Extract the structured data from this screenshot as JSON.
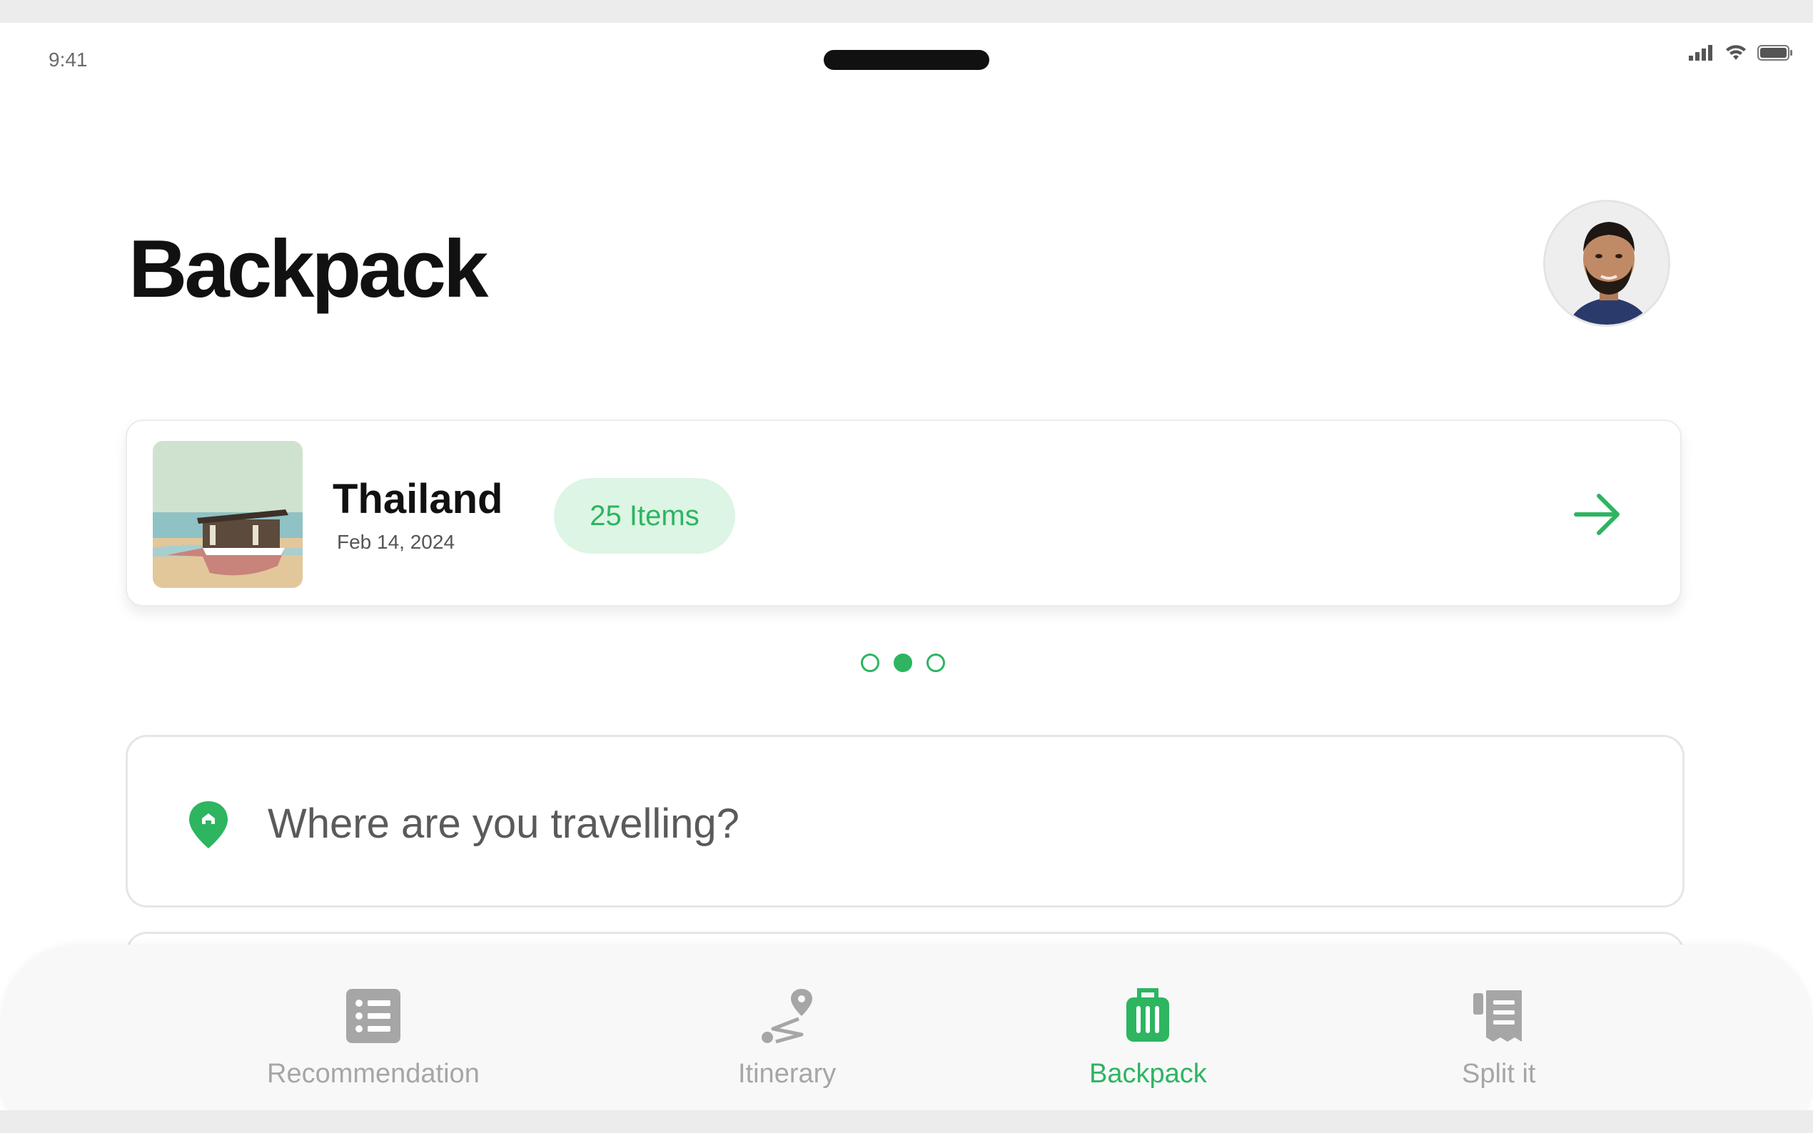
{
  "status_bar": {
    "time": "9:41"
  },
  "header": {
    "title": "Backpack"
  },
  "trip_card": {
    "name": "Thailand",
    "date": "Feb 14, 2024",
    "items_badge": "25 Items"
  },
  "pagination": {
    "total": 3,
    "active_index": 1
  },
  "search": {
    "placeholder": "Where are you travelling?"
  },
  "bottom_nav": {
    "items": [
      {
        "label": "Recommendation",
        "icon": "list-icon",
        "active": false
      },
      {
        "label": "Itinerary",
        "icon": "route-pin-icon",
        "active": false
      },
      {
        "label": "Backpack",
        "icon": "luggage-icon",
        "active": true
      },
      {
        "label": "Split it",
        "icon": "receipt-icon",
        "active": false
      }
    ]
  },
  "colors": {
    "accent": "#2db560",
    "badge_bg": "#ddf5e4",
    "inactive": "#a6a6a6"
  }
}
